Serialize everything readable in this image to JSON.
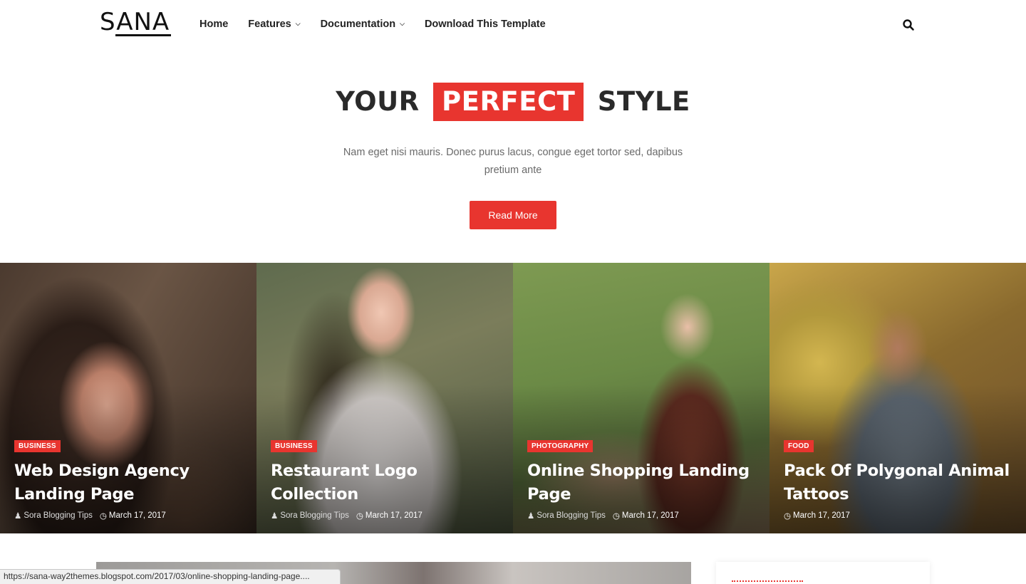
{
  "header": {
    "logo": "SANA",
    "nav": [
      {
        "label": "Home",
        "dropdown": false
      },
      {
        "label": "Features",
        "dropdown": true
      },
      {
        "label": "Documentation",
        "dropdown": true
      },
      {
        "label": "Download This Template",
        "dropdown": false
      }
    ],
    "search_icon": "search-icon"
  },
  "hero": {
    "title_pre": "YOUR",
    "title_highlight": "PERFECT",
    "title_post": "STYLE",
    "subtitle": "Nam eget nisi mauris. Donec purus lacus, congue eget tortor sed, dapibus pretium ante",
    "button": "Read More"
  },
  "cards": [
    {
      "category": "BUSINESS",
      "title": "Web Design Agency Landing Page",
      "author": "Sora Blogging Tips",
      "date": "March 17, 2017"
    },
    {
      "category": "BUSINESS",
      "title": "Restaurant Logo Collection",
      "author": "Sora Blogging Tips",
      "date": "March 17, 2017"
    },
    {
      "category": "PHOTOGRAPHY",
      "title": "Online Shopping Landing Page",
      "author": "Sora Blogging Tips",
      "date": "March 17, 2017"
    },
    {
      "category": "FOOD",
      "title": "Pack Of Polygonal Animal Tattoos",
      "author": "",
      "date": "March 17, 2017"
    }
  ],
  "status_url": "https://sana-way2themes.blogspot.com/2017/03/online-shopping-landing-page....",
  "colors": {
    "accent": "#e8352f",
    "text": "#222222",
    "muted": "#6a6a6a"
  }
}
